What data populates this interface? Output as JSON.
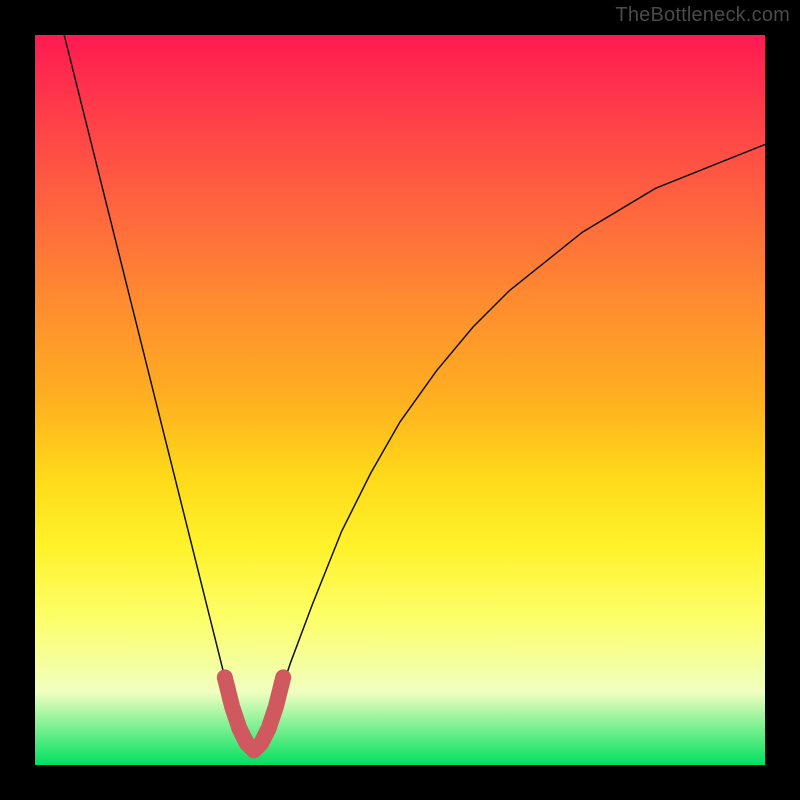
{
  "watermark": "TheBottleneck.com",
  "colors": {
    "background": "#000000",
    "curve": "#111111",
    "valley_marker": "#d0585f",
    "gradient_stops": [
      "#ff1a52",
      "#ff3b4a",
      "#ff6040",
      "#ff8a30",
      "#ffb020",
      "#ffd81a",
      "#fff22a",
      "#fdff6a",
      "#f0ffc0",
      "#00e060"
    ]
  },
  "chart_data": {
    "type": "line",
    "title": "",
    "xlabel": "",
    "ylabel": "",
    "xlim": [
      0,
      100
    ],
    "ylim": [
      0,
      100
    ],
    "series": [
      {
        "name": "bottleneck-curve",
        "x": [
          4,
          6,
          8,
          10,
          12,
          14,
          16,
          18,
          20,
          22,
          24,
          25,
          26,
          27,
          28,
          29,
          30,
          31,
          32,
          33,
          35,
          38,
          42,
          46,
          50,
          55,
          60,
          65,
          70,
          75,
          80,
          85,
          90,
          95,
          100
        ],
        "y": [
          100,
          92,
          84,
          76,
          68,
          60,
          52,
          44,
          36,
          28,
          20,
          16,
          12,
          8,
          5,
          3,
          2,
          3,
          5,
          8,
          14,
          22,
          32,
          40,
          47,
          54,
          60,
          65,
          69,
          73,
          76,
          79,
          81,
          83,
          85
        ]
      }
    ],
    "annotations": [
      {
        "name": "valley-marker",
        "x": [
          26,
          27,
          28,
          29,
          30,
          31,
          32,
          33,
          34
        ],
        "y": [
          12,
          8,
          5,
          3,
          2,
          3,
          5,
          8,
          12
        ]
      }
    ]
  }
}
